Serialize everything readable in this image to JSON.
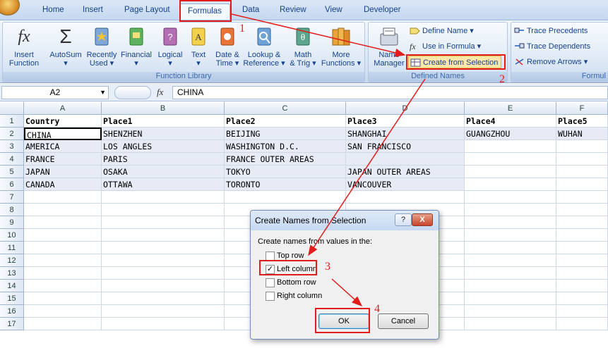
{
  "tabs": [
    "Home",
    "Insert",
    "Page Layout",
    "Formulas",
    "Data",
    "Review",
    "View",
    "Developer"
  ],
  "ribbon": {
    "function_library": {
      "label": "Function Library",
      "insert_function": {
        "l1": "Insert",
        "l2": "Function"
      },
      "autosum": "AutoSum",
      "recently_used": {
        "l1": "Recently",
        "l2": "Used"
      },
      "financial": "Financial",
      "logical": "Logical",
      "text": "Text",
      "date_time": {
        "l1": "Date &",
        "l2": "Time"
      },
      "lookup_reference": {
        "l1": "Lookup &",
        "l2": "Reference"
      },
      "math_trig": {
        "l1": "Math",
        "l2": "& Trig"
      },
      "more_functions": {
        "l1": "More",
        "l2": "Functions"
      }
    },
    "defined_names": {
      "label": "Defined Names",
      "name_manager": {
        "l1": "Name",
        "l2": "Manager"
      },
      "define_name": "Define Name",
      "use_in_formula": "Use in Formula",
      "create_from_selection": "Create from Selection"
    },
    "formula_auditing": {
      "label": "Formul",
      "trace_precedents": "Trace Precedents",
      "trace_dependents": "Trace Dependents",
      "remove_arrows": "Remove Arrows"
    }
  },
  "formula_bar": {
    "name_box": "A2",
    "fx": "fx",
    "value": "CHINA"
  },
  "sheet": {
    "columns": [
      "A",
      "B",
      "C",
      "D",
      "E",
      "F"
    ],
    "rows": [
      "1",
      "2",
      "3",
      "4",
      "5",
      "6",
      "7",
      "8",
      "9",
      "10",
      "11",
      "12",
      "13",
      "14",
      "15",
      "16",
      "17"
    ],
    "cells": [
      [
        "Country",
        "Place1",
        "Place2",
        "Place3",
        "Place4",
        "Place5"
      ],
      [
        "CHINA",
        "SHENZHEN",
        "BEIJING",
        "SHANGHAI",
        "GUANGZHOU",
        "WUHAN"
      ],
      [
        "AMERICA",
        "LOS ANGLES",
        "WASHINGTON D.C.",
        "SAN FRANCISCO",
        "",
        ""
      ],
      [
        "FRANCE",
        "PARIS",
        "FRANCE OUTER AREAS",
        "",
        "",
        ""
      ],
      [
        "JAPAN",
        "OSAKA",
        "TOKYO",
        "JAPAN OUTER AREAS",
        "",
        ""
      ],
      [
        "CANADA",
        "OTTAWA",
        "TORONTO",
        "VANCOUVER",
        "",
        ""
      ]
    ]
  },
  "dialog": {
    "title": "Create Names from Selection",
    "help": "?",
    "close": "X",
    "prompt": "Create names from values in the:",
    "options": [
      {
        "label": "Top row",
        "checked": false
      },
      {
        "label": "Left column",
        "checked": true
      },
      {
        "label": "Bottom row",
        "checked": false
      },
      {
        "label": "Right column",
        "checked": false
      }
    ],
    "ok": "OK",
    "cancel": "Cancel"
  },
  "annotations": [
    "1",
    "2",
    "3",
    "4"
  ],
  "colors": {
    "annotation": "#e21b1b",
    "ribbon_text": "#15428b"
  }
}
